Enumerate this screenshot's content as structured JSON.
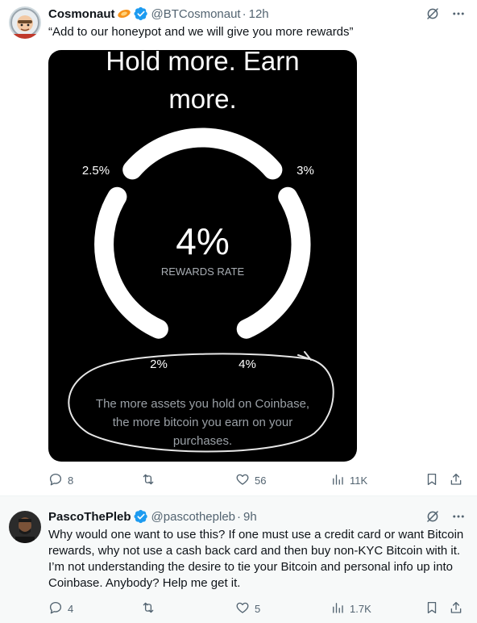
{
  "tweets": [
    {
      "author": {
        "name": "Cosmonaut",
        "handle": "@BTCosmonaut",
        "time": "12h",
        "emoji_icon": "rocket-icon"
      },
      "text": "“Add to our honeypot and we will give you more rewards”",
      "media": {
        "headline_line1": "Hold more. Earn",
        "headline_line2": "more.",
        "center_value": "4%",
        "center_label": "REWARDS RATE",
        "gauge_labels": [
          "2.5%",
          "3%",
          "2%",
          "4%"
        ],
        "caption_line1": "The more assets you hold on Coinbase,",
        "caption_line2": "the more bitcoin you earn on your",
        "caption_line3": "purchases."
      },
      "stats": {
        "replies": "8",
        "reposts": "",
        "likes": "56",
        "views": "11K"
      }
    },
    {
      "author": {
        "name": "PascoThePleb",
        "handle": "@pascothepleb",
        "time": "9h"
      },
      "text": "Why would one want to use this? If one must use a credit card or want Bitcoin rewards, why not use a cash back card and then buy non-KYC Bitcoin with it. I’m not understanding the desire to tie your Bitcoin and personal info up into Coinbase. Anybody? Help me get it.",
      "stats": {
        "replies": "4",
        "reposts": "",
        "likes": "5",
        "views": "1.7K"
      }
    }
  ],
  "colors": {
    "verified": "#1d9bf0",
    "muted": "#536471",
    "media_bg": "#000000",
    "accent_orange": "#f7931a"
  }
}
